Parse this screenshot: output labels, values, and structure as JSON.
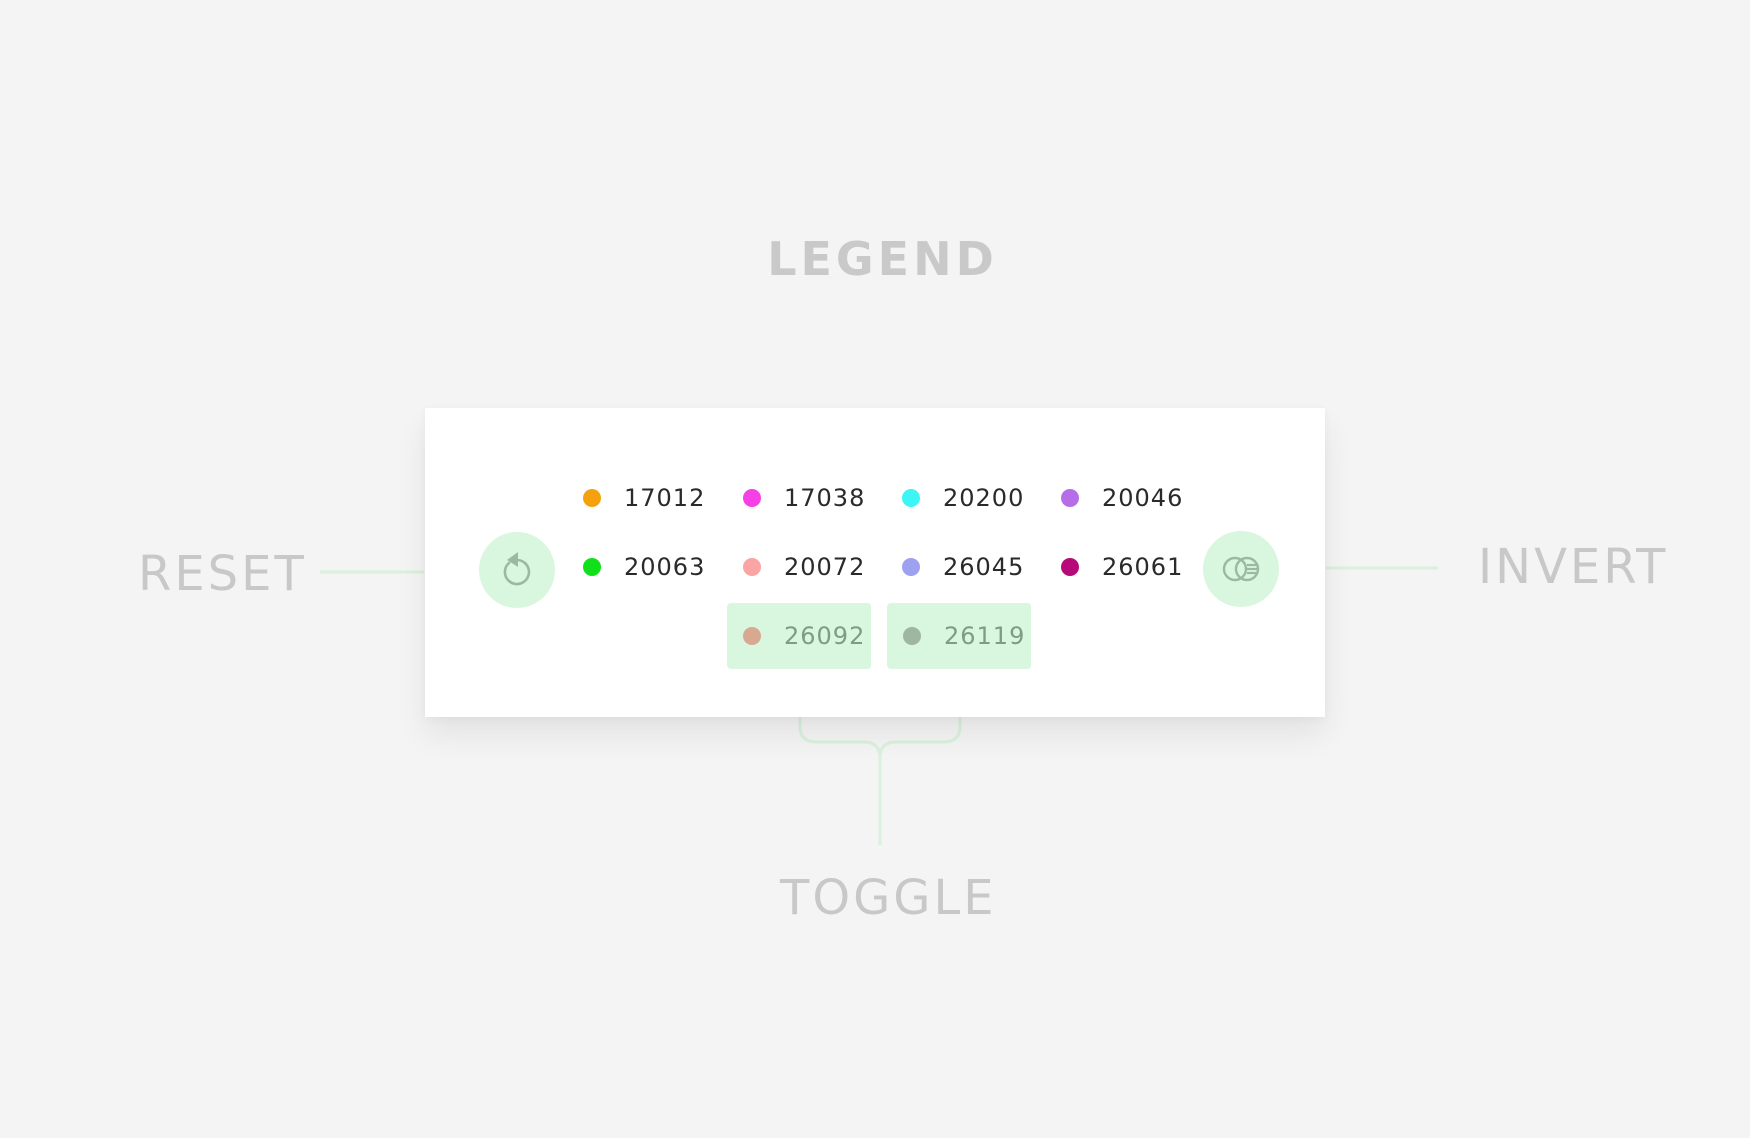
{
  "heading": "LEGEND",
  "callouts": {
    "reset": "RESET",
    "invert": "INVERT",
    "toggle": "TOGGLE"
  },
  "buttons": {
    "reset": {
      "icon": "reset-icon"
    },
    "invert": {
      "icon": "invert-icon"
    }
  },
  "colors": {
    "background": "#f4f4f4",
    "panel": "#ffffff",
    "accent_light_green": "#d9f6df",
    "icon_gray_green": "#9cb8a2",
    "callout_text": "#c8c8c8"
  },
  "legend": {
    "items": [
      {
        "label": "17012",
        "color": "#f5a10d",
        "hidden": false
      },
      {
        "label": "17038",
        "color": "#f540e6",
        "hidden": false
      },
      {
        "label": "20200",
        "color": "#3df5f5",
        "hidden": false
      },
      {
        "label": "20046",
        "color": "#b66ee8",
        "hidden": false
      },
      {
        "label": "20063",
        "color": "#10e01a",
        "hidden": false
      },
      {
        "label": "20072",
        "color": "#f8a5a3",
        "hidden": false
      },
      {
        "label": "26045",
        "color": "#9da1f0",
        "hidden": false
      },
      {
        "label": "26061",
        "color": "#b70a7a",
        "hidden": false
      },
      {
        "label": "26092",
        "color": "#d8a890",
        "hidden": true
      },
      {
        "label": "26119",
        "color": "#9fb7a2",
        "hidden": true
      }
    ]
  }
}
